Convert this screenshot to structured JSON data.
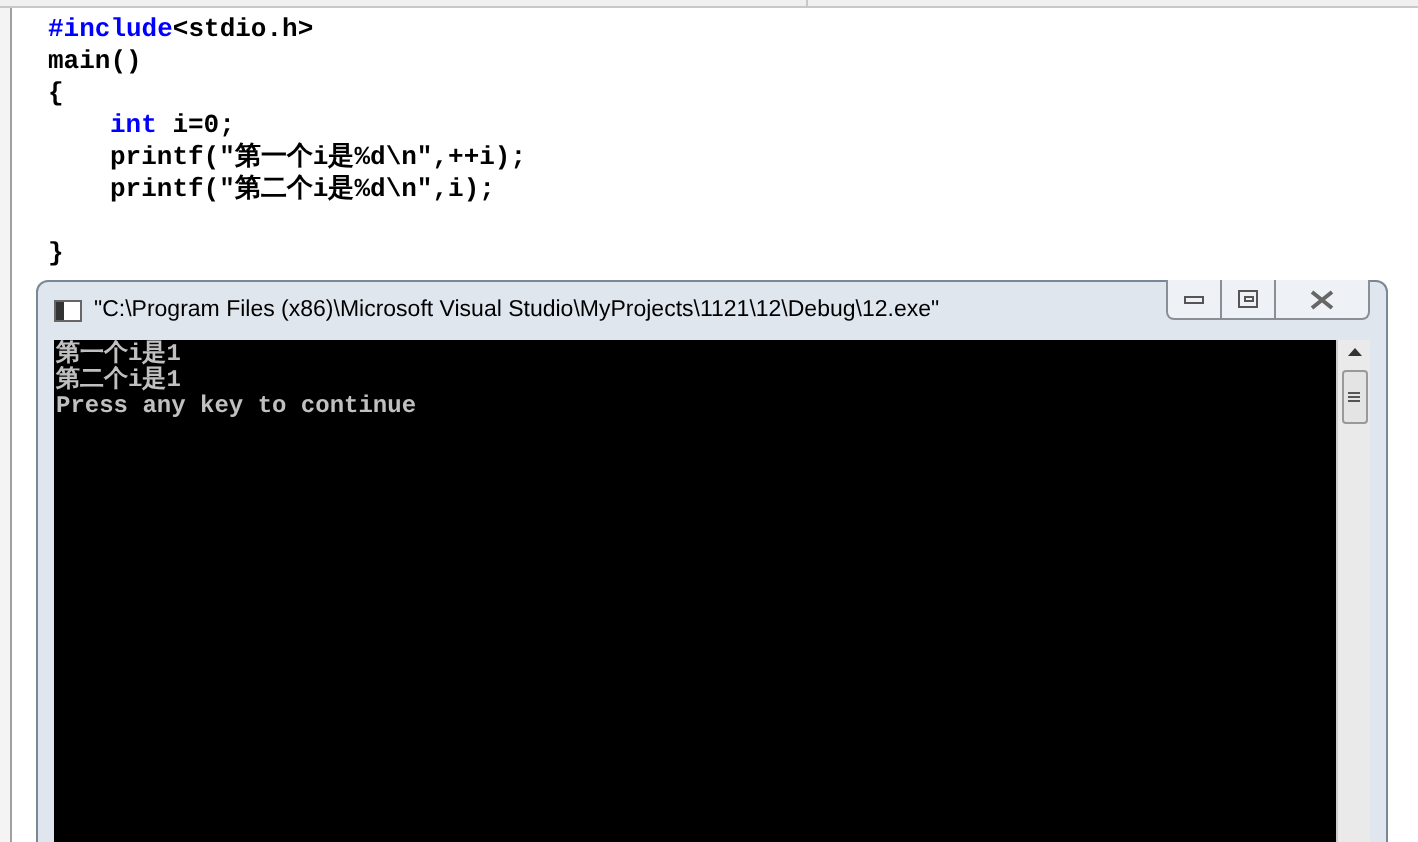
{
  "editor": {
    "lines": [
      {
        "kind": "code",
        "indented": false,
        "tokens": [
          {
            "kind": "keyword",
            "text": "#include"
          },
          {
            "kind": "plain",
            "text": "<stdio.h>"
          }
        ]
      },
      {
        "kind": "code",
        "indented": false,
        "tokens": [
          {
            "kind": "plain",
            "text": "main()"
          }
        ]
      },
      {
        "kind": "code",
        "indented": false,
        "tokens": [
          {
            "kind": "plain",
            "text": "{"
          }
        ]
      },
      {
        "kind": "code",
        "indented": true,
        "tokens": [
          {
            "kind": "keyword",
            "text": "int"
          },
          {
            "kind": "plain",
            "text": " i=0;"
          }
        ]
      },
      {
        "kind": "code",
        "indented": true,
        "tokens": [
          {
            "kind": "plain",
            "text": "printf(\"第一个i是%d\\n\",++i);"
          }
        ]
      },
      {
        "kind": "code",
        "indented": true,
        "tokens": [
          {
            "kind": "plain",
            "text": "printf(\"第二个i是%d\\n\",i);"
          }
        ]
      },
      {
        "kind": "blank"
      },
      {
        "kind": "code",
        "indented": false,
        "tokens": [
          {
            "kind": "plain",
            "text": "}"
          }
        ]
      }
    ]
  },
  "console": {
    "title": "\"C:\\Program Files (x86)\\Microsoft Visual Studio\\MyProjects\\1121\\12\\Debug\\12.exe\"",
    "output": [
      "第一个i是1",
      "第二个i是1",
      "Press any key to continue"
    ]
  }
}
